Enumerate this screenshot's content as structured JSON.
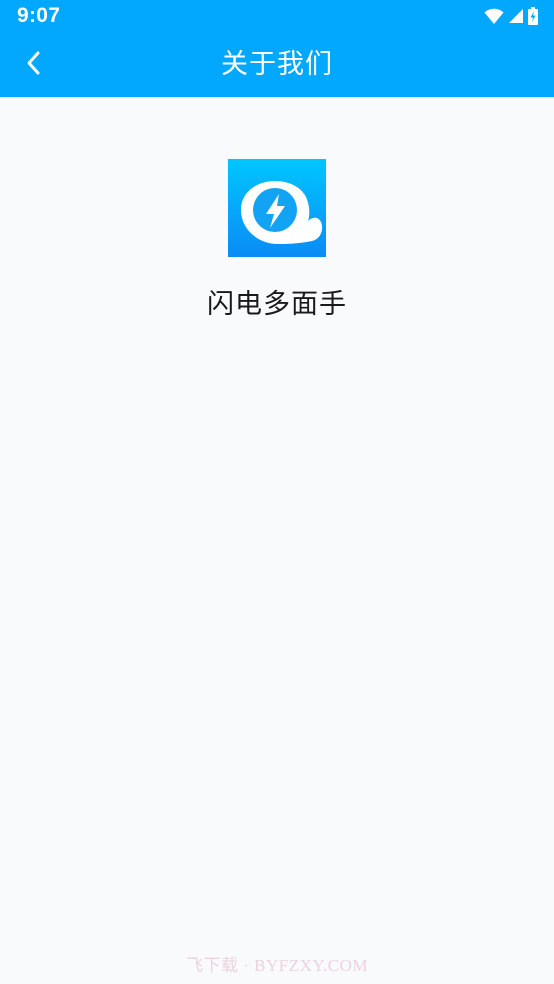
{
  "status_bar": {
    "time": "9:07",
    "icons": [
      "wifi-icon",
      "cellular-signal-icon",
      "battery-charging-icon"
    ]
  },
  "app_bar": {
    "back_icon": "chevron-left-icon",
    "title": "关于我们"
  },
  "colors": {
    "accent": "#02a8fe",
    "background": "#f9fafb",
    "text": "#1a1a1a"
  },
  "about": {
    "app_icon": "lightning-bubble-logo",
    "app_name": "闪电多面手"
  },
  "watermark": {
    "text": "飞下载 · BYFZXY.COM"
  }
}
